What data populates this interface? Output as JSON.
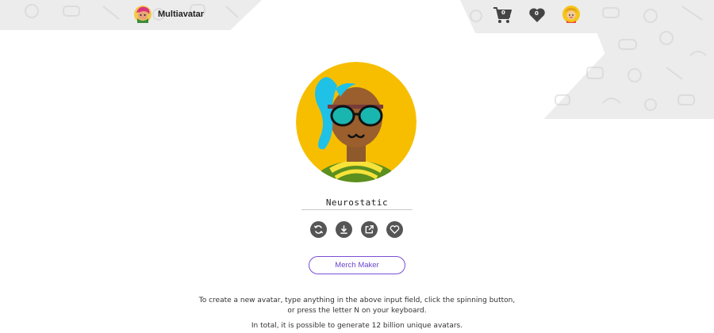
{
  "header": {
    "brand_name": "Multiavatar",
    "cart_count": "0",
    "favorites_count": "0"
  },
  "avatar": {
    "name_value": "Neurostatic"
  },
  "actions": {
    "icons": [
      "refresh-icon",
      "download-icon",
      "share-icon",
      "heart-icon"
    ]
  },
  "merch_button": {
    "label": "Merch Maker"
  },
  "description": {
    "line1": "To create a new avatar, type anything in the above input field, click the spinning button, or press the letter N on your keyboard.",
    "line2": "In total, it is possible to generate 12 billion unique avatars."
  },
  "colors": {
    "accent": "#7a4fd6",
    "icon_bg": "#555555",
    "avatar_bg": "#f7be00",
    "hair": "#1fc1e6"
  }
}
